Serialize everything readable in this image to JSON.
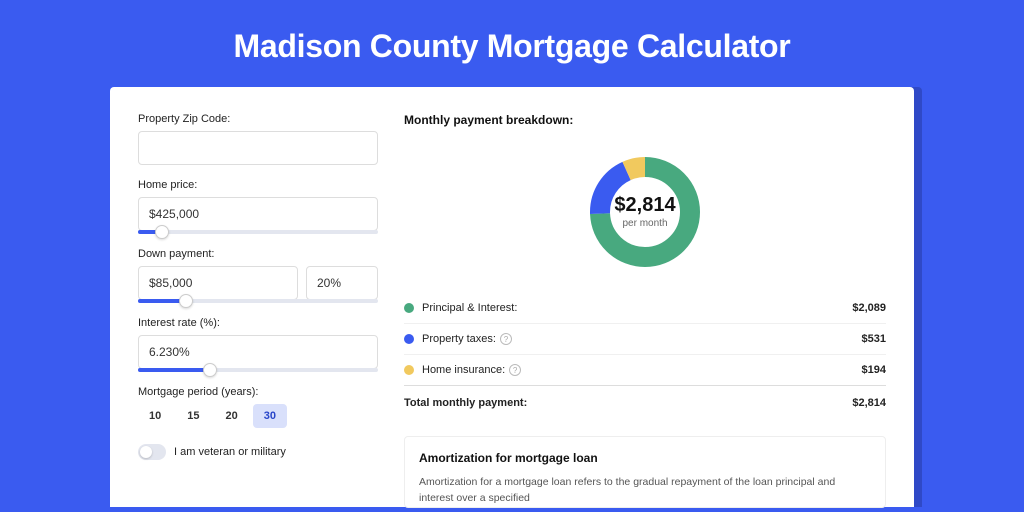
{
  "page": {
    "title": "Madison County Mortgage Calculator"
  },
  "form": {
    "zip_label": "Property Zip Code:",
    "zip_value": "",
    "home_price_label": "Home price:",
    "home_price_value": "$425,000",
    "home_price_slider_pct": 10,
    "down_payment_label": "Down payment:",
    "down_payment_value": "$85,000",
    "down_payment_pct_value": "20%",
    "down_payment_slider_pct": 20,
    "interest_rate_label": "Interest rate (%):",
    "interest_rate_value": "6.230%",
    "interest_rate_slider_pct": 30,
    "period_label": "Mortgage period (years):",
    "period_options": [
      "10",
      "15",
      "20",
      "30"
    ],
    "period_selected": "30",
    "veteran_label": "I am veteran or military"
  },
  "breakdown": {
    "title": "Monthly payment breakdown:",
    "total_display": "$2,814",
    "per_month_label": "per month",
    "items": [
      {
        "label": "Principal & Interest:",
        "value": "$2,089",
        "color": "#48a97f",
        "has_help": false
      },
      {
        "label": "Property taxes:",
        "value": "$531",
        "color": "#3a5bf0",
        "has_help": true
      },
      {
        "label": "Home insurance:",
        "value": "$194",
        "color": "#f1c95e",
        "has_help": true
      }
    ],
    "total_label": "Total monthly payment:",
    "total_value": "$2,814"
  },
  "amortization": {
    "title": "Amortization for mortgage loan",
    "text": "Amortization for a mortgage loan refers to the gradual repayment of the loan principal and interest over a specified"
  },
  "chart_data": {
    "type": "pie",
    "title": "Monthly payment breakdown",
    "categories": [
      "Principal & Interest",
      "Property taxes",
      "Home insurance"
    ],
    "values": [
      2089,
      531,
      194
    ],
    "total": 2814,
    "series_colors": [
      "#48a97f",
      "#3a5bf0",
      "#f1c95e"
    ]
  }
}
